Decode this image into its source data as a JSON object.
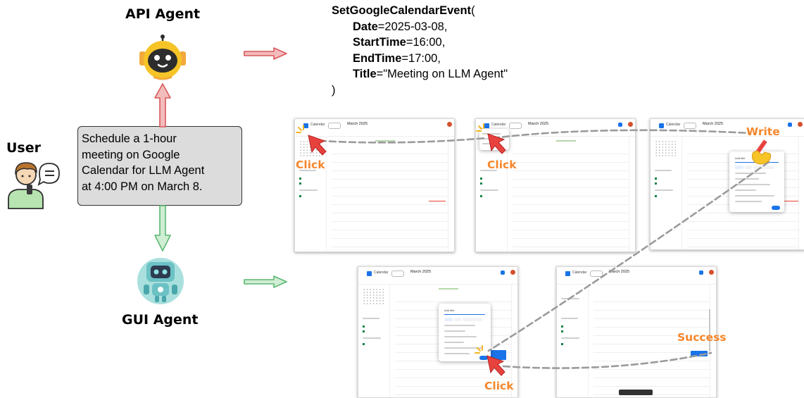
{
  "labels": {
    "api_agent": "API Agent",
    "gui_agent": "GUI Agent",
    "user": "User"
  },
  "task": {
    "lines": [
      "Schedule a 1-hour",
      "meeting on Google",
      "Calendar for LLM Agent",
      "at 4:00 PM on March 8."
    ]
  },
  "api_call": {
    "function": "SetGoogleCalendarEvent",
    "open": "(",
    "close": ")",
    "params": [
      {
        "key": "Date",
        "value": "=2025-03-08,"
      },
      {
        "key": "StartTime",
        "value": "=16:00,"
      },
      {
        "key": "EndTime",
        "value": "=17:00,"
      },
      {
        "key": "Title",
        "value": "=\"Meeting on LLM Agent\""
      }
    ]
  },
  "screens": {
    "app_name": "Calendar",
    "month": "March 2025",
    "today": "Today",
    "dialog_title": "Add title"
  },
  "annotations": {
    "click_1": "Click",
    "click_2": "Click",
    "write": "Write",
    "click_3": "Click",
    "success": "Success"
  },
  "colors": {
    "api_arrow": "#d9595c",
    "gui_arrow": "#8bd19c",
    "annotation": "#f6862a",
    "pointer": "#e8423f",
    "calendar_blue": "#1a73e8",
    "task_box": "#dcdcdc"
  }
}
